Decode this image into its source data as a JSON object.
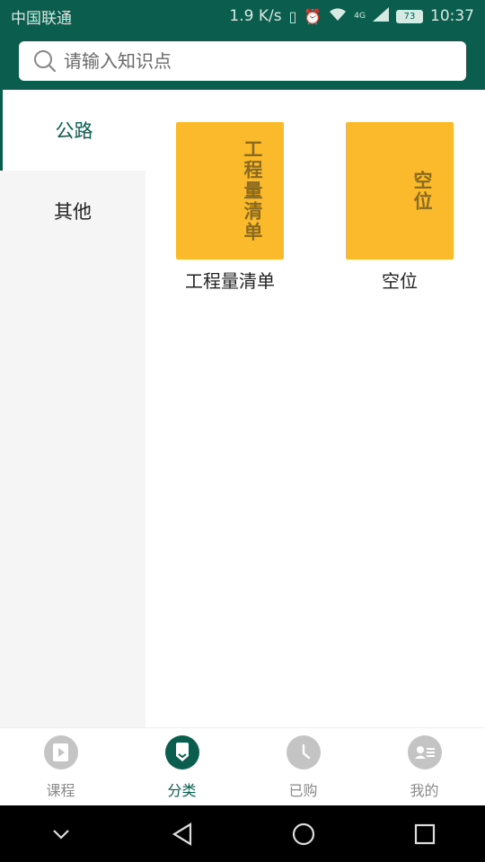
{
  "status_bar": {
    "carrier": "中国联通",
    "speed": "1.9 K/s",
    "battery": "73",
    "time": "10:37",
    "signal": "4G"
  },
  "search": {
    "placeholder": "请输入知识点"
  },
  "categories": [
    {
      "label": "公路",
      "active": true
    },
    {
      "label": "其他",
      "active": false
    }
  ],
  "items": [
    {
      "label": "工程量清单",
      "cover_text": "工程量清单"
    },
    {
      "label": "空位",
      "cover_text": "空位"
    }
  ],
  "tabs": [
    {
      "label": "课程",
      "icon": "play-book-icon",
      "active": false
    },
    {
      "label": "分类",
      "icon": "bookmark-icon",
      "active": true
    },
    {
      "label": "已购",
      "icon": "clock-icon",
      "active": false
    },
    {
      "label": "我的",
      "icon": "profile-card-icon",
      "active": false
    }
  ],
  "colors": {
    "primary": "#0b5e4d",
    "card": "#fbba2b",
    "inactive": "#c4c4c4"
  }
}
